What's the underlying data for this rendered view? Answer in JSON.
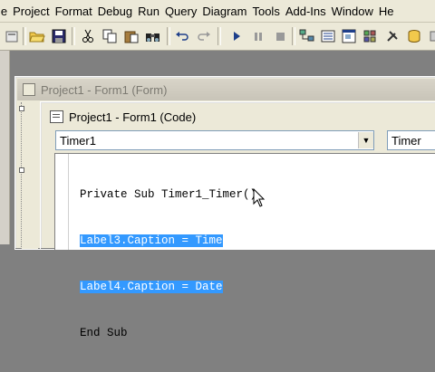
{
  "menubar": {
    "items": [
      "File",
      "Project",
      "Format",
      "Debug",
      "Run",
      "Query",
      "Diagram",
      "Tools",
      "Add-Ins",
      "Window",
      "Help"
    ],
    "visible_labels": [
      "le",
      "Project",
      "Format",
      "Debug",
      "Run",
      "Query",
      "Diagram",
      "Tools",
      "Add-Ins",
      "Window",
      "He"
    ]
  },
  "toolbar": {
    "buttons": [
      "open-folder-icon",
      "save-icon",
      "cut-icon",
      "copy-icon",
      "paste-icon",
      "find-icon",
      "undo-icon",
      "redo-icon",
      "run-icon",
      "break-icon",
      "stop-icon",
      "project-explorer-icon",
      "properties-icon",
      "form-layout-icon",
      "object-browser-icon",
      "toolbox-icon",
      "data-view-icon"
    ]
  },
  "form_window": {
    "title": "Project1 - Form1 (Form)"
  },
  "code_window": {
    "title": "Project1 - Form1 (Code)",
    "object_dropdown": "Timer1",
    "procedure_dropdown": "Timer",
    "lines": [
      {
        "text": "Private Sub Timer1_Timer()",
        "selected": false
      },
      {
        "text": "Label3.Caption = Time",
        "selected": true
      },
      {
        "text": "Label4.Caption = Date",
        "selected": true
      },
      {
        "text": "End Sub",
        "selected": false
      }
    ]
  },
  "colors": {
    "selection": "#3399ff",
    "chrome": "#ece9d8",
    "workspace": "#808080"
  }
}
